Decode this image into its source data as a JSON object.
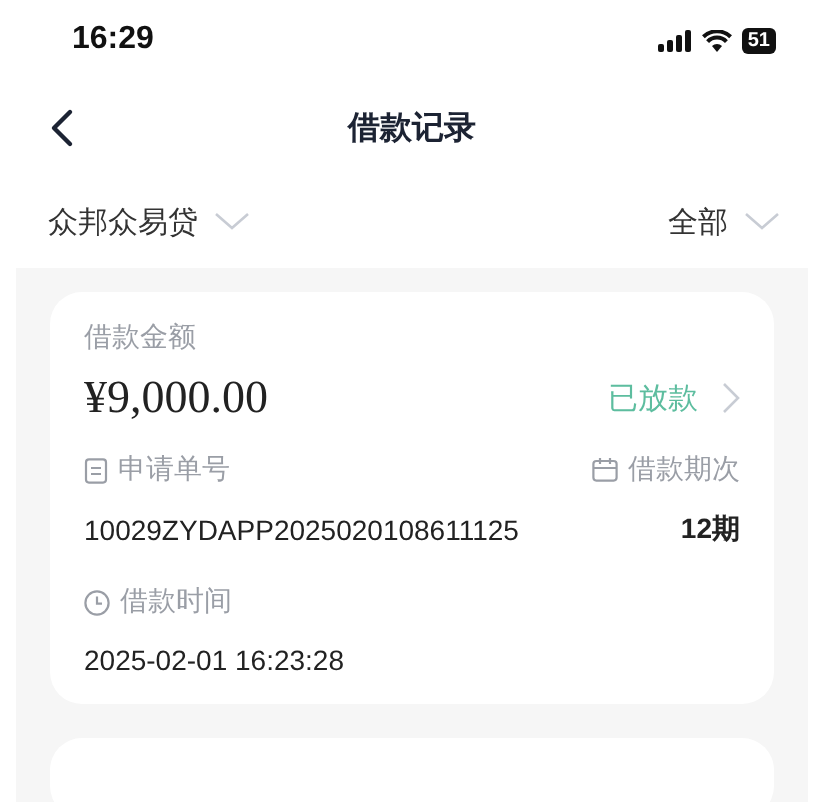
{
  "status_bar": {
    "time": "16:29",
    "battery": "51"
  },
  "nav": {
    "title": "借款记录"
  },
  "filters": [
    {
      "label": "众邦众易贷"
    },
    {
      "label": "全部"
    }
  ],
  "records": [
    {
      "amount_label": "借款金额",
      "amount": "¥9,000.00",
      "status": "已放款",
      "order_label": "申请单号",
      "order_no": "10029ZYDAPP2025020108611125",
      "term_label": "借款期次",
      "term": "12期",
      "time_label": "借款时间",
      "time": "2025-02-01 16:23:28"
    }
  ]
}
